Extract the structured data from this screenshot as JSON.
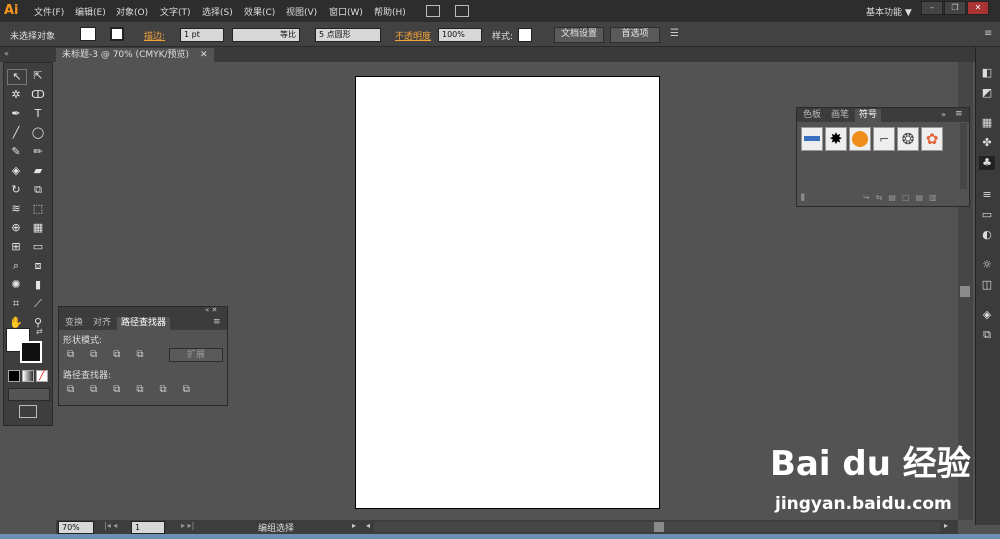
{
  "app": {
    "logo": "Ai"
  },
  "menu": [
    "文件(F)",
    "编辑(E)",
    "对象(O)",
    "文字(T)",
    "选择(S)",
    "效果(C)",
    "视图(V)",
    "窗口(W)",
    "帮助(H)"
  ],
  "workspace": {
    "label": "基本功能",
    "arrow": "▼"
  },
  "window_controls": {
    "min": "–",
    "max": "❐",
    "close": "✕"
  },
  "control_bar": {
    "selection": "未选择对象",
    "stroke_label": "描边:",
    "stroke_weight": "1 pt",
    "stroke_profile": "等比",
    "brush": "5 点圆形",
    "opacity_label": "不透明度",
    "opacity_value": "100%",
    "style_label": "样式:",
    "doc_setup": "文档设置",
    "preferences": "首选项"
  },
  "document": {
    "tab": "未标题-3 @ 70% (CMYK/预览)",
    "close": "✕"
  },
  "symbols_panel": {
    "tabs": [
      "色板",
      "画笔",
      "符号"
    ],
    "active_tab": "符号",
    "menu_icon": "≡"
  },
  "pathfinder_panel": {
    "tabs": [
      "变换",
      "对齐",
      "路径查找器"
    ],
    "active_tab": "路径查找器",
    "shape_modes_label": "形状模式:",
    "expand_button": "扩展",
    "pathfinders_label": "路径查找器:"
  },
  "status": {
    "zoom": "70%",
    "page": "1",
    "tool_status": "编组选择"
  },
  "watermark": {
    "brand": "Bai du 经验",
    "url": "jingyan.baidu.com"
  },
  "colors": {
    "accent": "#f7941d",
    "canvas": "#535353",
    "artboard": "#ffffff"
  }
}
